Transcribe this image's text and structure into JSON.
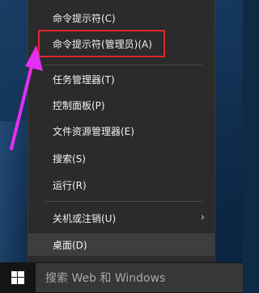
{
  "menu": {
    "items": [
      {
        "label": "命令提示符(C)"
      },
      {
        "label": "命令提示符(管理员)(A)"
      },
      {
        "label": "任务管理器(T)"
      },
      {
        "label": "控制面板(P)"
      },
      {
        "label": "文件资源管理器(E)"
      },
      {
        "label": "搜索(S)"
      },
      {
        "label": "运行(R)"
      },
      {
        "label": "关机或注销(U)",
        "has_submenu": true
      },
      {
        "label": "桌面(D)"
      }
    ],
    "submenu_arrow": "›"
  },
  "taskbar": {
    "search_placeholder": "搜索 Web 和 Windows",
    "start_icon": "windows-logo-icon"
  },
  "annotation": {
    "highlight_color": "#e0262a",
    "arrow_color": "#e52ff0"
  }
}
